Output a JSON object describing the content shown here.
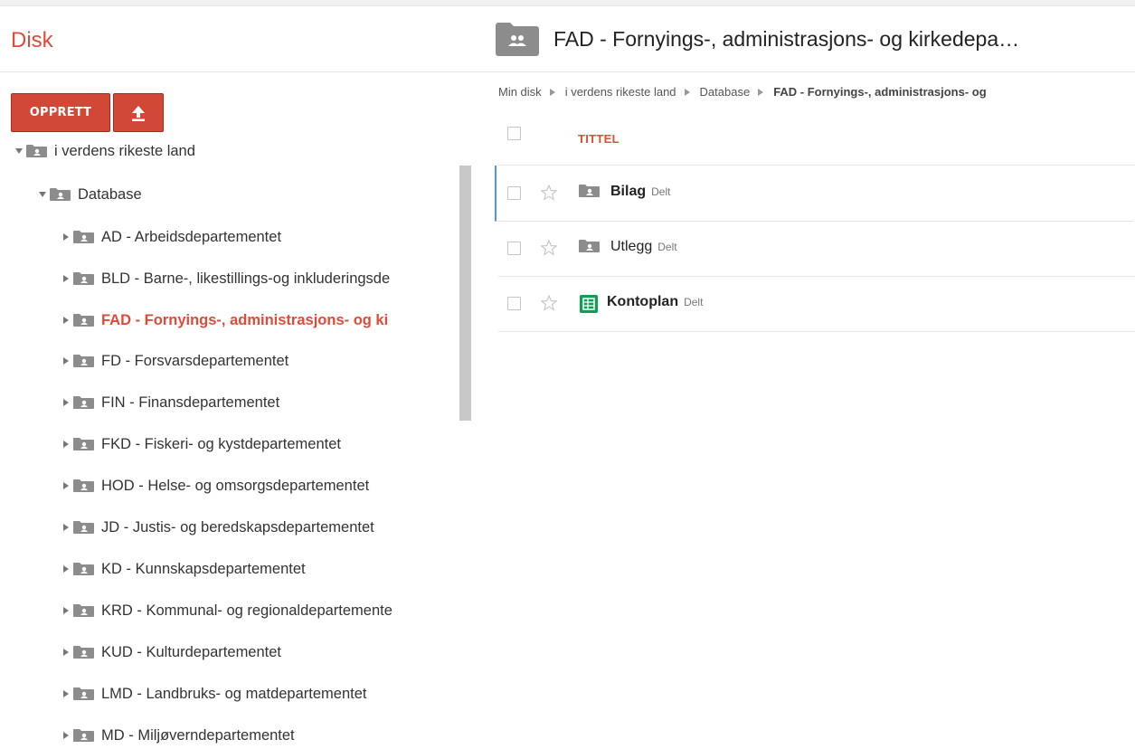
{
  "app": {
    "title": "Disk"
  },
  "header": {
    "folder_title": "FAD - Fornyings-, administrasjons- og kirkedepa…"
  },
  "buttons": {
    "create": "OPPRETT",
    "upload_icon": "upload-arrow-icon"
  },
  "tree": {
    "root": "i verdens rikeste land",
    "database": "Database",
    "items": [
      "AD - Arbeidsdepartementet",
      "BLD - Barne-, likestillings-og inkluderingsde",
      "FAD - Fornyings-, administrasjons- og ki",
      "FD - Forsvarsdepartementet",
      "FIN - Finansdepartementet",
      "FKD - Fiskeri- og kystdepartementet",
      "HOD - Helse- og omsorgsdepartementet",
      "JD - Justis- og beredskapsdepartementet",
      "KD - Kunnskapsdepartementet",
      "KRD - Kommunal- og regionaldepartemente",
      "KUD - Kulturdepartementet",
      "LMD - Landbruks- og matdepartementet",
      "MD - Miljøverndepartementet"
    ],
    "active_item": "FAD - Fornyings-, administrasjons- og ki"
  },
  "breadcrumb": [
    "Min disk",
    "i verdens rikeste land",
    "Database",
    "FAD - Fornyings-, administrasjons- og"
  ],
  "list": {
    "column_title": "TITTEL",
    "files": [
      {
        "name": "Bilag",
        "badge": "Delt",
        "type": "shared-folder"
      },
      {
        "name": "Utlegg",
        "badge": "Delt",
        "type": "shared-folder"
      },
      {
        "name": "Kontoplan",
        "badge": "Delt",
        "type": "spreadsheet"
      }
    ]
  },
  "colors": {
    "accent": "#dd4b39",
    "button": "#d14836",
    "selection": "#4d90fe",
    "folder": "#8c8c8c"
  }
}
